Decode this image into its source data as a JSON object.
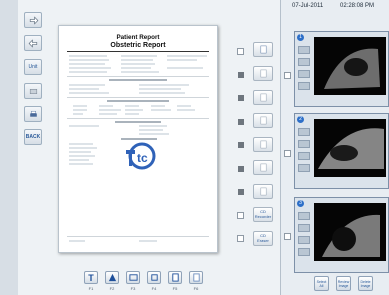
{
  "header": {
    "date": "07-Jul-2011",
    "time": "02:28:08 PM"
  },
  "left_toolbar": {
    "btn3_label": "Unit",
    "btn4_label": "",
    "btn6_label": "BACK"
  },
  "report": {
    "title": "Patient Report",
    "subtitle": "Obstetric Report",
    "logo_text": "tc"
  },
  "middle_buttons": {
    "btn8_label": "CD\nRecorder",
    "btn9_label": "CD\nEraser"
  },
  "thumbnails": [
    {
      "num": "1"
    },
    {
      "num": "2"
    },
    {
      "num": "3"
    }
  ],
  "bottom_toolbar": {
    "labels": [
      "F1",
      "F2",
      "F3",
      "F4",
      "F5",
      "F6"
    ]
  },
  "right_bottom_buttons": {
    "b1": "Select\nAll",
    "b2": "Review\nImage",
    "b3": "Delete\nImage"
  },
  "colors": {
    "accent": "#2d6fc8",
    "panel": "#eef2f5"
  }
}
